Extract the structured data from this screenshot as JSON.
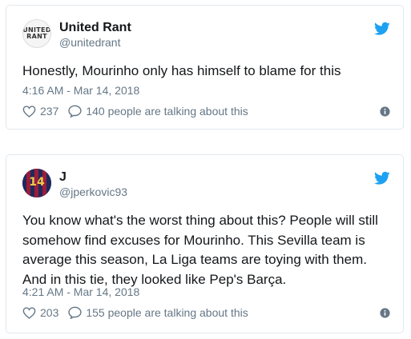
{
  "tweets": [
    {
      "author_name": "United Rant",
      "handle": "@unitedrant",
      "avatar_text_line1": "UNITED",
      "avatar_text_line2": "RANT",
      "text": "Honestly, Mourinho only has himself to blame for this",
      "timestamp": "4:16 AM - Mar 14, 2018",
      "likes": "237",
      "talking": "140 people are talking about this"
    },
    {
      "author_name": "J",
      "handle": "@jperkovic93",
      "avatar_jersey_number": "14",
      "text": "You know what's the worst thing about this? People will still somehow find excuses for Mourinho. This Sevilla team is average this season, La Liga teams are toying with them. And in this tie, they looked like Pep's Barça.",
      "timestamp": "4:21 AM - Mar 14, 2018",
      "likes": "203",
      "talking": "155 people are talking about this"
    }
  ],
  "colors": {
    "twitter_blue": "#1da1f2",
    "muted": "#657786",
    "border": "#e1e8ed",
    "text": "#14171a"
  },
  "icons": [
    "twitter-bird-icon",
    "heart-icon",
    "reply-bubble-icon",
    "info-icon"
  ]
}
